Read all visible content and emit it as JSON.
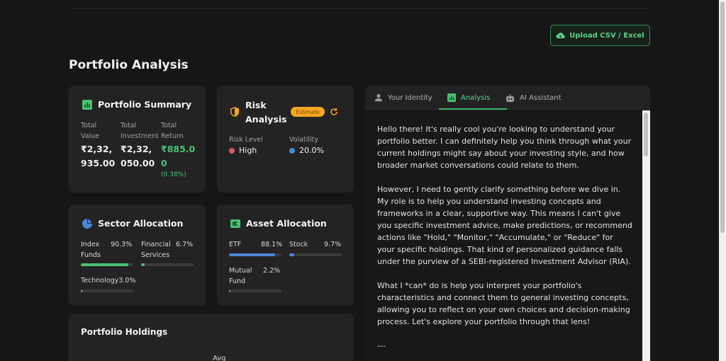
{
  "header": {
    "upload_label": "Upload CSV / Excel",
    "page_title": "Portfolio Analysis"
  },
  "summary": {
    "title": "Portfolio Summary",
    "total_value_label_1": "Total",
    "total_value_label_2": "Value",
    "total_value_1": "₹2,32,",
    "total_value_2": "935.00",
    "total_investment_label_1": "Total",
    "total_investment_label_2": "Investment",
    "total_investment_1": "₹2,32,",
    "total_investment_2": "050.00",
    "total_return_label_1": "Total",
    "total_return_label_2": "Return",
    "total_return_1": "₹885.0",
    "total_return_2": "0",
    "total_return_pct": "(0.38%)"
  },
  "risk": {
    "title_1": "Risk",
    "title_2": "Analysis",
    "badge": "Estimate",
    "risk_level_label": "Risk Level",
    "risk_level": "High",
    "volatility_label": "Volatility",
    "volatility": "20.0%"
  },
  "sector": {
    "title": "Sector Allocation",
    "items": [
      {
        "name_1": "Index",
        "name_2": "Funds",
        "pct": "90.3%",
        "fraction": 0.903
      },
      {
        "name_1": "Financial",
        "name_2": "Services",
        "pct": "6.7%",
        "fraction": 0.067
      },
      {
        "name_1": "Technology",
        "name_2": "",
        "pct": "3.0%",
        "fraction": 0.03
      }
    ]
  },
  "asset": {
    "title": "Asset Allocation",
    "items": [
      {
        "name_1": "ETF",
        "name_2": "",
        "pct": "88.1%",
        "fraction": 0.881
      },
      {
        "name_1": "Stock",
        "name_2": "",
        "pct": "9.7%",
        "fraction": 0.097
      },
      {
        "name_1": "Mutual",
        "name_2": "Fund",
        "pct": "2.2%",
        "fraction": 0.022
      }
    ]
  },
  "holdings": {
    "title": "Portfolio Holdings",
    "col_partial": "Avg"
  },
  "tabs": [
    {
      "label": "Your Identity",
      "icon": "user-icon"
    },
    {
      "label": "Analysis",
      "icon": "chart-icon",
      "active": true
    },
    {
      "label": "AI Assistant",
      "icon": "robot-icon"
    }
  ],
  "chat": {
    "p1": "Hello there! It's really cool you're looking to understand your portfolio better. I can definitely help you think through what your current holdings might say about your investing style, and how broader market conversations could relate to them.",
    "p2": "However, I need to gently clarify something before we dive in. My role is to help you understand investing concepts and frameworks in a clear, supportive way. This means I can't give you specific investment advice, make predictions, or recommend actions like \"Hold,\" \"Monitor,\" \"Accumulate,\" or \"Reduce\" for your specific holdings. That kind of personalized guidance falls under the purview of a SEBI-registered Investment Advisor (RIA).",
    "p3": "What I *can* do is help you interpret your portfolio's characteristics and connect them to general investing concepts, allowing you to reflect on your own choices and decision-making process. Let's explore your portfolio through that lens!",
    "p4": "---"
  },
  "colors": {
    "accent_green": "#5fd08a",
    "bar_green": "#4cc173",
    "bar_blue": "#4a86d8",
    "risk_red": "#e05a5a",
    "vol_blue": "#3d8fd1",
    "badge_orange": "#f5a623"
  }
}
